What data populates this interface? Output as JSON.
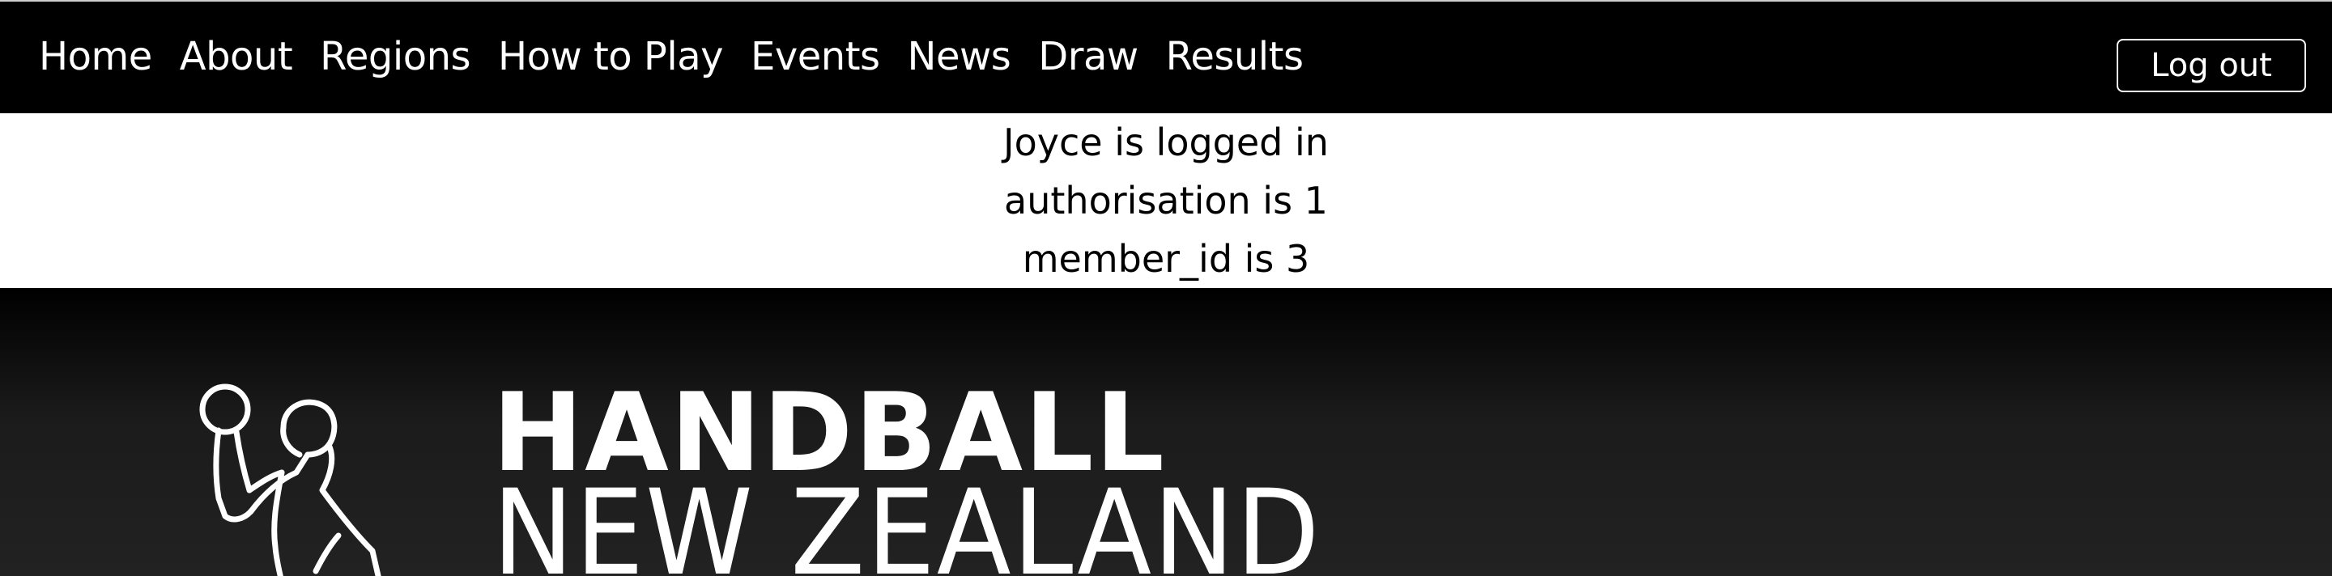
{
  "nav": {
    "links": [
      {
        "label": "Home"
      },
      {
        "label": "About"
      },
      {
        "label": "Regions"
      },
      {
        "label": "How to Play"
      },
      {
        "label": "Events"
      },
      {
        "label": "News"
      },
      {
        "label": "Draw"
      },
      {
        "label": "Results"
      }
    ],
    "logout_label": "Log out"
  },
  "status": {
    "line1": "Joyce is logged in",
    "line2": "authorisation is 1",
    "line3": "member_id is 3"
  },
  "hero": {
    "logo_line1": "HANDBALL",
    "logo_line2": "NEW ZEALAND",
    "logo_icon": "handball-player-icon"
  },
  "colors": {
    "nav_background": "#000000",
    "nav_text": "#ffffff",
    "hero_background": "#1b1b1b"
  }
}
